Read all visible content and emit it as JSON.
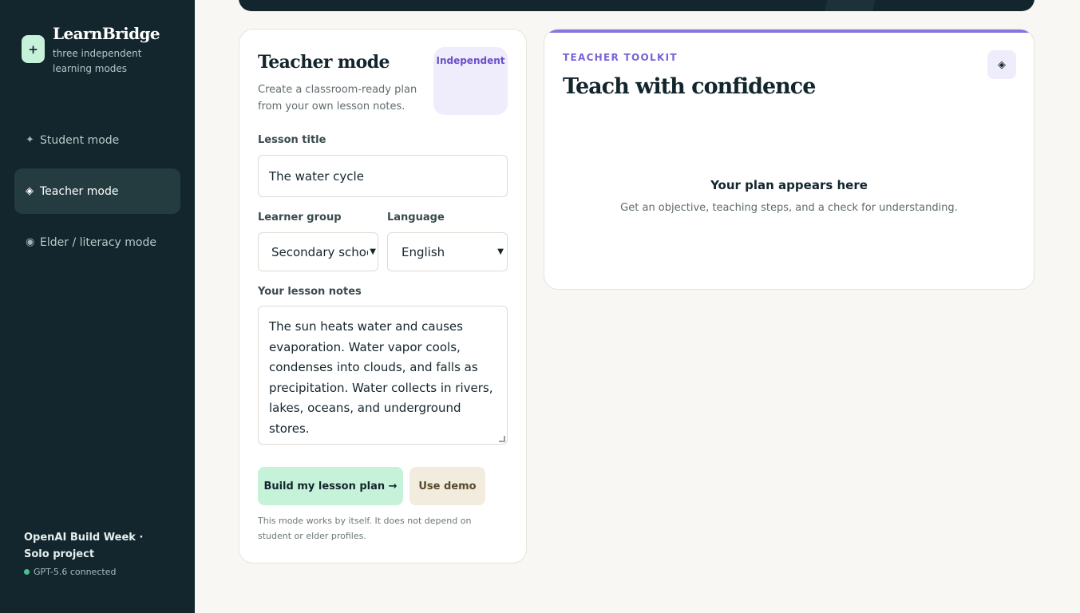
{
  "sidebar": {
    "brand": {
      "badge": "+",
      "name": "LearnBridge",
      "subtitle": "three independent learning modes"
    },
    "items": [
      {
        "icon": "✦",
        "label": "Student mode"
      },
      {
        "icon": "◈",
        "label": "Teacher mode"
      },
      {
        "icon": "◉",
        "label": "Elder / literacy mode"
      }
    ],
    "footer": {
      "title": "OpenAI Build Week · Solo project",
      "status": "GPT-5.6 connected"
    }
  },
  "form": {
    "title": "Teacher mode",
    "description": "Create a classroom-ready plan from your own lesson notes.",
    "badge": "Independent",
    "lesson_title_label": "Lesson title",
    "lesson_title_value": "The water cycle",
    "learner_group_label": "Learner group",
    "learner_group_value": "Secondary school",
    "language_label": "Language",
    "language_value": "English",
    "notes_label": "Your lesson notes",
    "notes_value": "The sun heats water and causes evaporation. Water vapor cools, condenses into clouds, and falls as precipitation. Water collects in rivers, lakes, oceans, and underground stores.",
    "build_button": "Build my lesson plan →",
    "demo_button": "Use demo",
    "note": "This mode works by itself. It does not depend on student or elder profiles."
  },
  "output": {
    "eyebrow": "TEACHER TOOLKIT",
    "title": "Teach with confidence",
    "icon": "◈",
    "empty_title": "Your plan appears here",
    "empty_subtitle": "Get an objective, teaching steps, and a check for understanding."
  },
  "colors": {
    "sidebar": "#13262d",
    "accent_green": "#c6f2d9",
    "accent_purple": "#8b72e0",
    "background": "#f8f7f3"
  }
}
